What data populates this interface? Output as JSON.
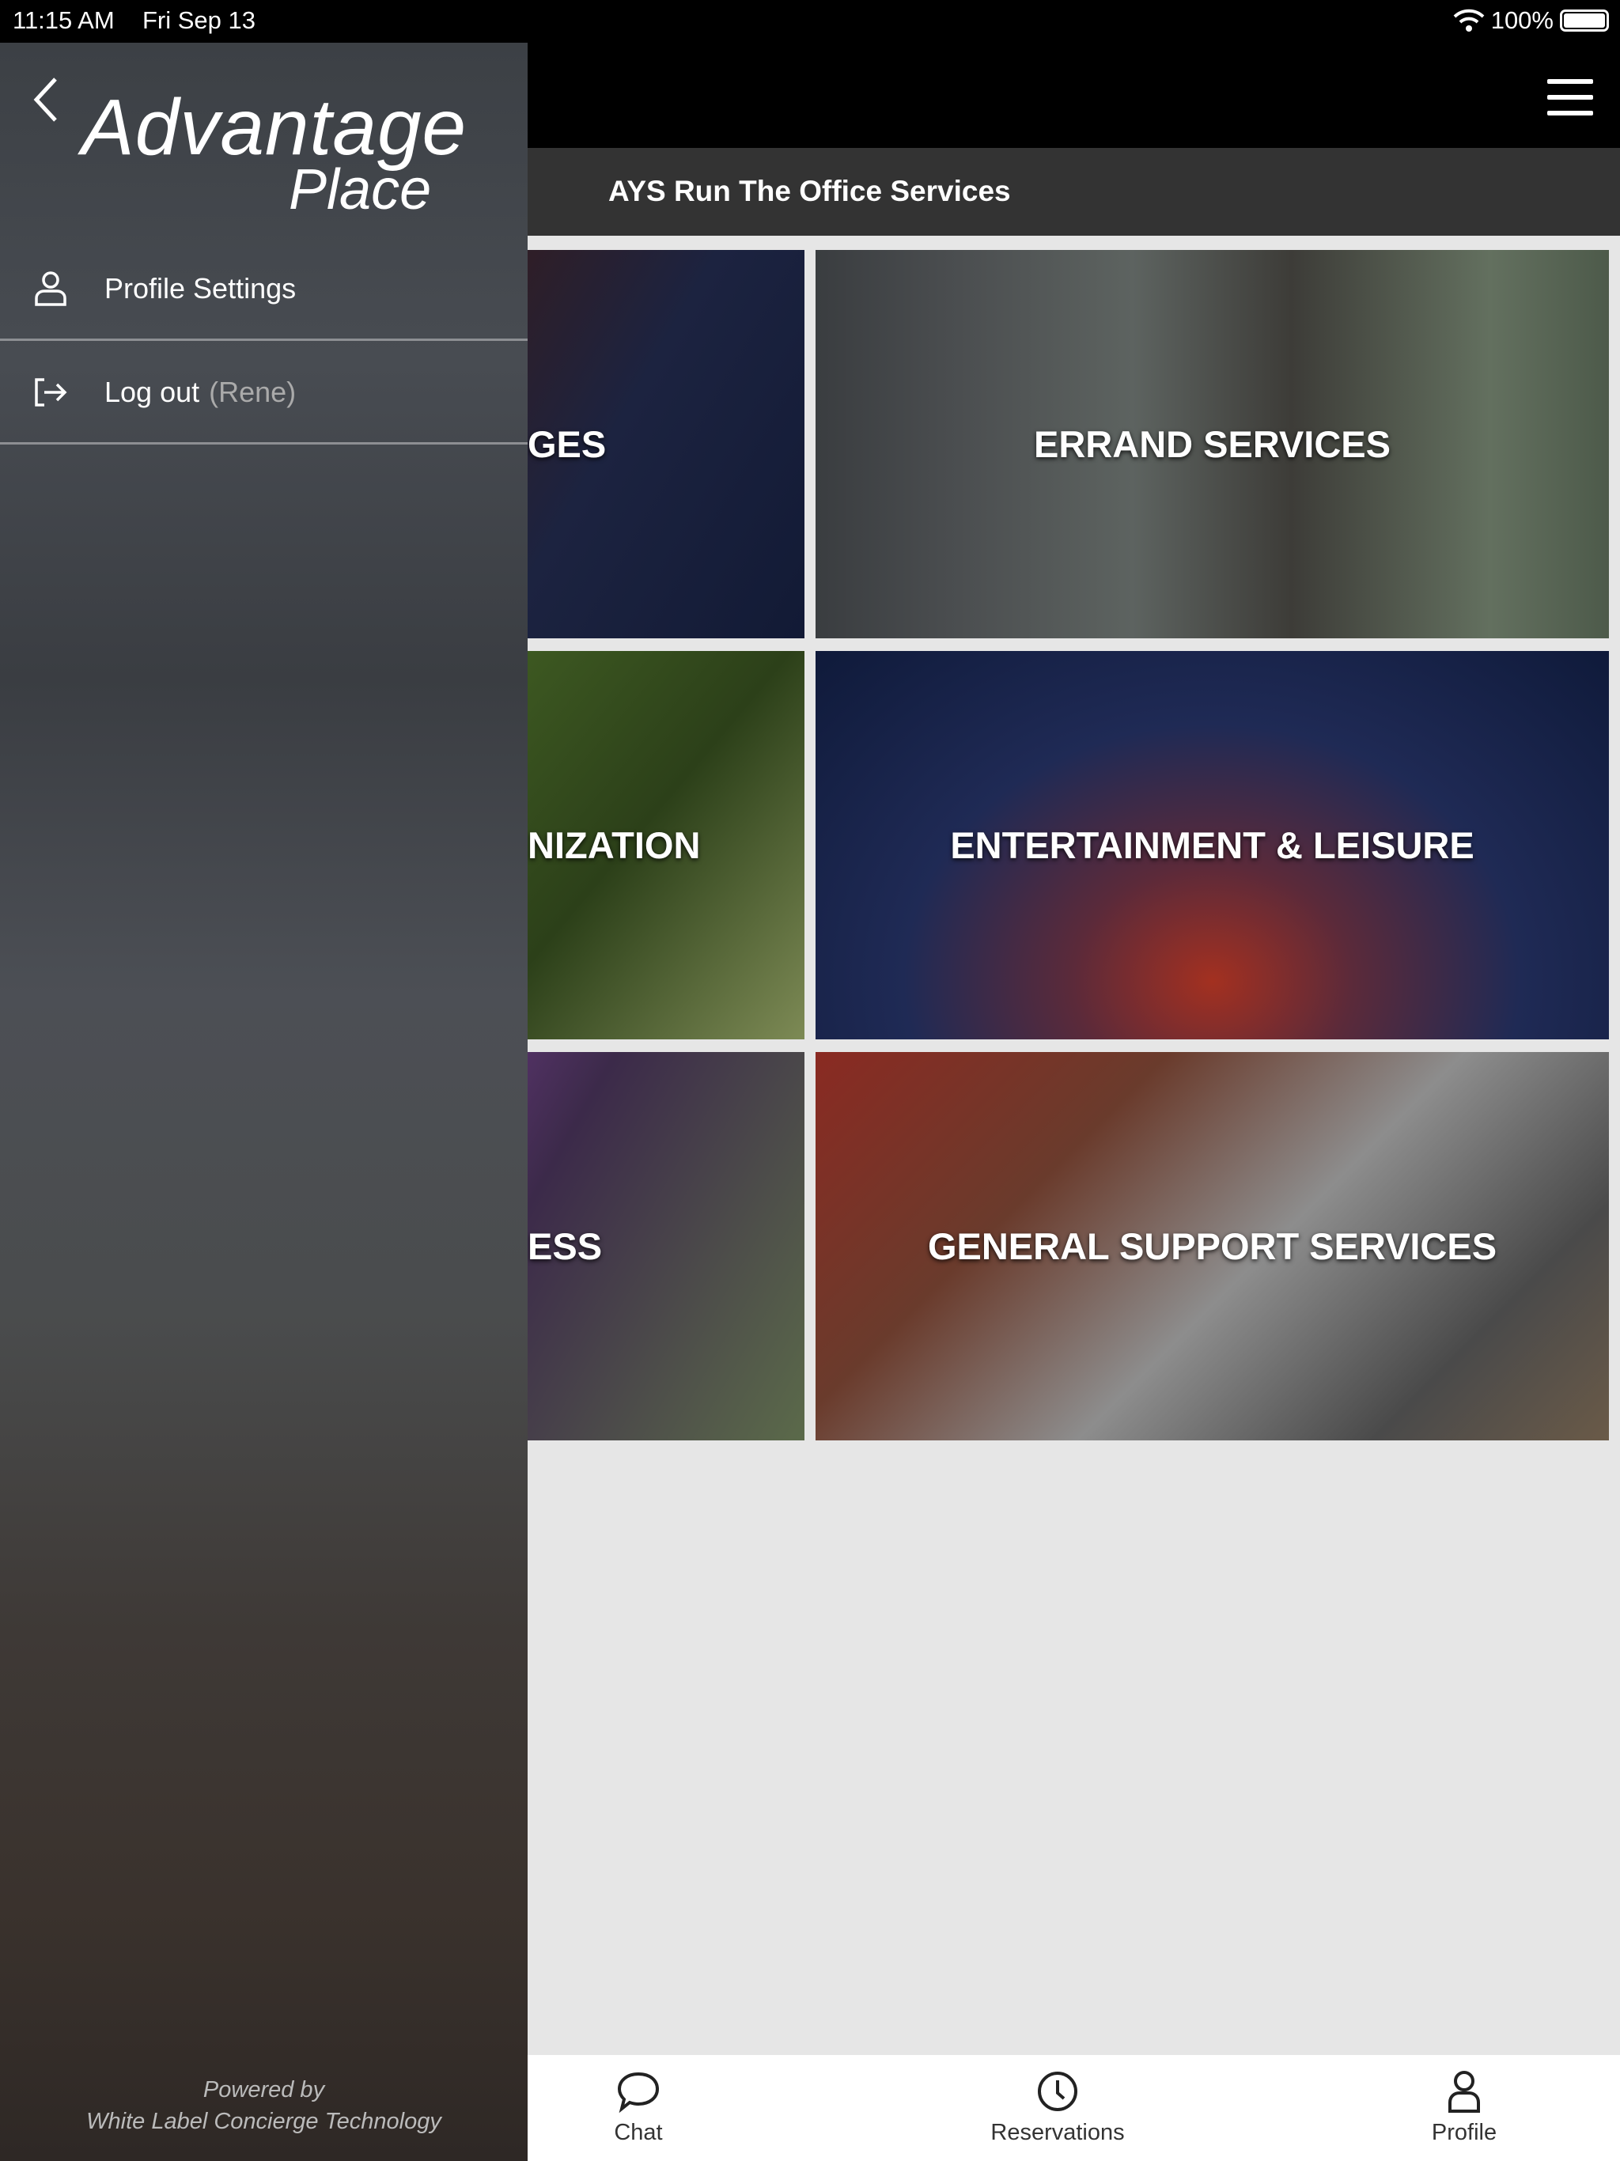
{
  "status_bar": {
    "time": "11:15 AM",
    "date": "Fri Sep 13",
    "battery": "100%",
    "battery_level": 100
  },
  "header": {
    "title": "AYS Run The Office Services",
    "menu_icon": "hamburger-icon"
  },
  "tiles": [
    {
      "label": "GES"
    },
    {
      "label": "ERRAND SERVICES"
    },
    {
      "label": "NIZATION"
    },
    {
      "label": "ENTERTAINMENT & LEISURE"
    },
    {
      "label": "ESS"
    },
    {
      "label": "GENERAL SUPPORT SERVICES"
    }
  ],
  "drawer": {
    "logo": {
      "line1": "Advantage",
      "line2": "Place"
    },
    "items": [
      {
        "label": "Profile Settings",
        "icon": "user-icon"
      },
      {
        "label": "Log out",
        "sub": "(Rene)",
        "icon": "logout-icon"
      }
    ],
    "footer": {
      "line1": "Powered by",
      "line2": "White Label Concierge Technology"
    }
  },
  "tabbar": [
    {
      "label": "Chat",
      "icon": "chat-icon"
    },
    {
      "label": "Reservations",
      "icon": "clock-icon"
    },
    {
      "label": "Profile",
      "icon": "user-icon"
    }
  ]
}
